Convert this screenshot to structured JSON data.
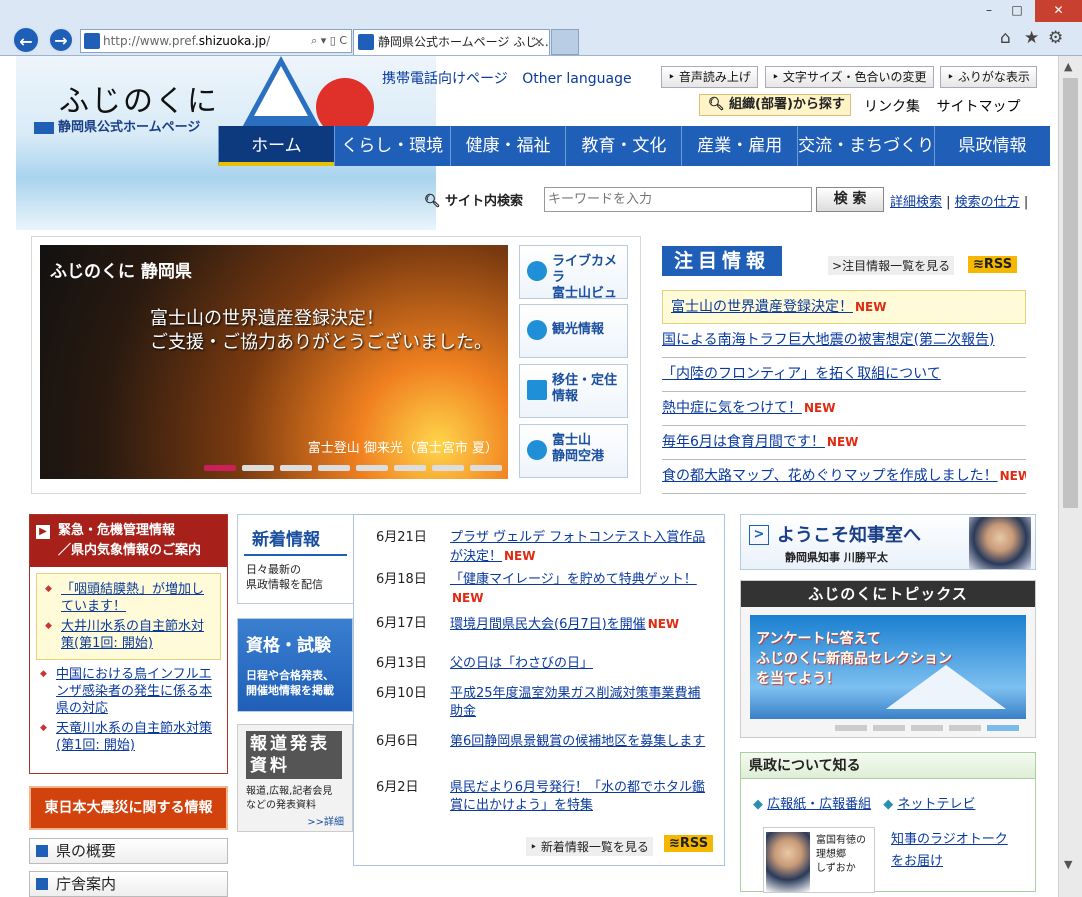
{
  "browser": {
    "url_prefix": "http://www.pref.",
    "url_host": "shizuoka.jp",
    "url_suffix": "/",
    "address_tools": "⌕ ▾ ▯ C",
    "tab_title": "静岡県公式ホームページ ふじ...",
    "back_glyph": "←",
    "fwd_glyph": "→",
    "close_glyph": "✕",
    "min_glyph": "–",
    "max_glyph": "□",
    "home_glyph": "⌂",
    "star_glyph": "★",
    "gear_glyph": "⚙"
  },
  "header": {
    "logo_title": "ふじのくに",
    "logo_sub": "静岡県公式ホームページ",
    "mobile_link": "携帯電話向けページ",
    "other_lang": "Other language",
    "voice_btn": "音声読み上げ",
    "fontsize_btn": "文字サイズ・色合いの変更",
    "furigana_btn": "ふりがな表示",
    "org_btn": "組織(部署)から探す",
    "links": "リンク集",
    "sitemap": "サイトマップ"
  },
  "gnav": [
    "ホーム",
    "くらし・環境",
    "健康・福祉",
    "教育・文化",
    "産業・雇用",
    "交流・まちづくり",
    "県政情報"
  ],
  "search": {
    "label": "サイト内検索",
    "placeholder": "キーワードを入力",
    "button": "検 索",
    "advanced": "詳細検索",
    "howto": "検索の仕方"
  },
  "hero": {
    "brand": "ふじのくに 静岡県",
    "line1": "富士山の世界遺産登録決定！",
    "line2": "ご支援・ご協力ありがとうございました。",
    "caption": "富士登山 御来光（富士宮市 夏）",
    "slide_count": 8,
    "active_slide": 1
  },
  "side_buttons": [
    {
      "label": "ライブカメラ\n富士山ビュー",
      "icon": "camera-icon"
    },
    {
      "label": "観光情報",
      "icon": "mountain-icon"
    },
    {
      "label": "移住・定住\n情報",
      "icon": "building-icon"
    },
    {
      "label": "富士山\n静岡空港",
      "icon": "airport-icon"
    }
  ],
  "notice": {
    "heading": "注目情報",
    "more": "注目情報一覧を見る",
    "rss": "RSS",
    "items": [
      {
        "text": "富士山の世界遺産登録決定！",
        "new": true,
        "highlight": true
      },
      {
        "text": "国による南海トラフ巨大地震の被害想定(第二次報告)",
        "new": false
      },
      {
        "text": "「内陸のフロンティア」を拓く取組について",
        "new": false
      },
      {
        "text": "熱中症に気をつけて！",
        "new": true
      },
      {
        "text": "毎年6月は食育月間です！",
        "new": true
      },
      {
        "text": "食の都大路マップ、花めぐりマップを作成しました！",
        "new": true
      }
    ],
    "new_label": "NEW"
  },
  "emergency": {
    "heading": "緊急・危機管理情報\n／県内気象情報のご案内",
    "boxed": [
      "「咽頭結膜熱」が増加しています！",
      "大井川水系の自主節水対策(第1回: 開始)"
    ],
    "items": [
      "中国における鳥インフルエンザ感染者の発生に係る本県の対応",
      "天竜川水系の自主節水対策(第1回: 開始)"
    ]
  },
  "quake": "東日本大震災に関する情報",
  "left_nav": [
    "県の概要",
    "庁舎案内"
  ],
  "news_tabs": {
    "new_title": "新着情報",
    "new_sub": "日々最新の\n県政情報を配信",
    "exam_title": "資格・試験",
    "exam_sub": "日程や合格発表、\n開催地情報を掲載",
    "press_title": "報道発表\n資料",
    "press_sub": "報道,広報,記者会見\nなどの発表資料",
    "press_more": ">>詳細"
  },
  "news": [
    {
      "date": "6月21日",
      "text": "プラザ ヴェルデ フォトコンテスト入賞作品が決定！",
      "new": true
    },
    {
      "date": "6月18日",
      "text": "「健康マイレージ」を貯めて特典ゲット！",
      "new": true
    },
    {
      "date": "6月17日",
      "text": "環境月間県民大会(6月7日)を開催",
      "new": true
    },
    {
      "date": "6月13日",
      "text": "父の日は「わさびの日」",
      "new": false
    },
    {
      "date": "6月10日",
      "text": "平成25年度温室効果ガス削減対策事業費補助金",
      "new": false
    },
    {
      "date": "6月6日",
      "text": "第6回静岡県景観賞の候補地区を募集します",
      "new": false
    },
    {
      "date": "6月2日",
      "text": "県民だより6月号発行！「水の都でホタル鑑賞に出かけよう」を特集",
      "new": false
    }
  ],
  "news_more": "新着情報一覧を見る",
  "news_rss": "RSS",
  "governor": {
    "title": "ようこそ知事室へ",
    "sub": "静岡県知事 川勝平太"
  },
  "topics": {
    "heading": "ふじのくにトピックス",
    "banner": "アンケートに答えて\nふじのくに新商品セレクション\nを当てよう！",
    "dot_count": 5,
    "active_dot": 5
  },
  "know": {
    "heading": "県政について知る",
    "link1": "広報紙・広報番組",
    "link2": "ネットテレビ",
    "radio_caption": "富国有徳の\n理想郷\nしずおか",
    "radio_link": "知事のラジオトーク\nをお届け"
  }
}
